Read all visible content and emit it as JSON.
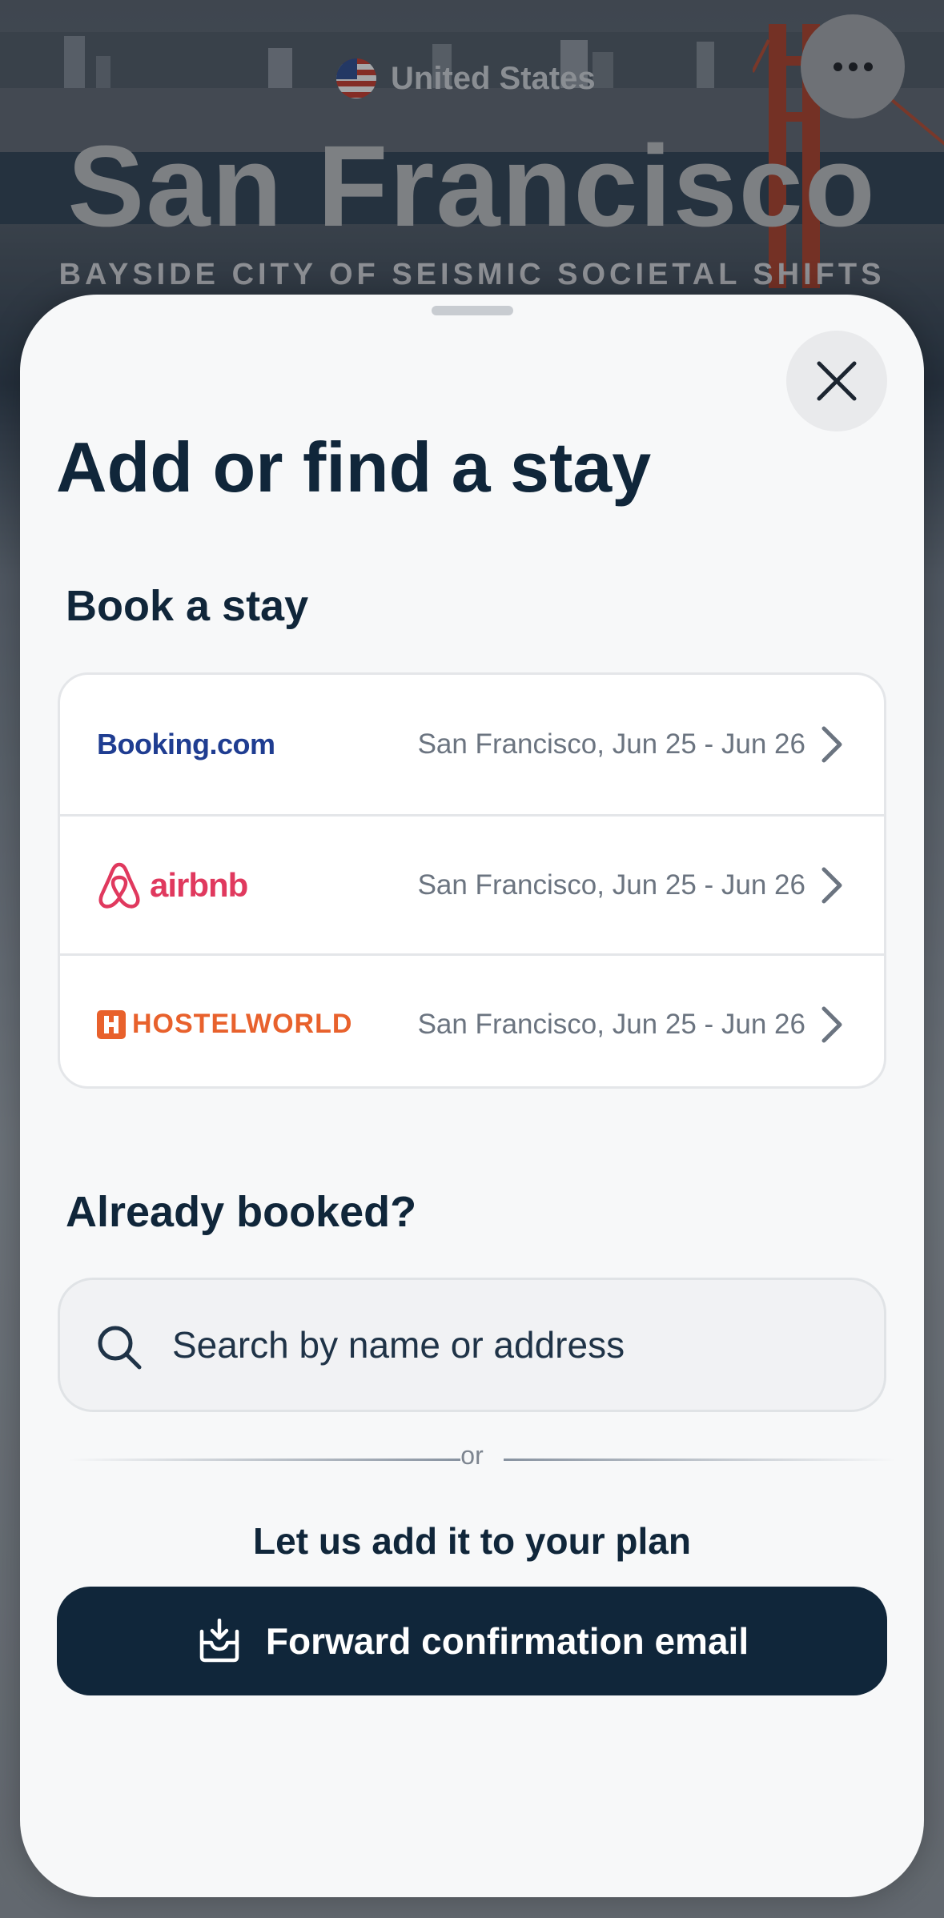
{
  "header": {
    "country": "United States",
    "city": "San Francisco",
    "tagline": "BAYSIDE CITY OF SEISMIC SOCIETAL SHIFTS"
  },
  "sheet": {
    "title": "Add or find a stay",
    "book_section": {
      "title": "Book a stay",
      "providers": [
        {
          "name": "Booking.com",
          "detail": "San Francisco, Jun 25 - Jun 26",
          "brand_color": "#1f3d91"
        },
        {
          "name": "airbnb",
          "detail": "San Francisco, Jun 25 - Jun 26",
          "brand_color": "#e0395e"
        },
        {
          "name": "HOSTELWORLD",
          "detail": "San Francisco, Jun 25 - Jun 26",
          "brand_color": "#e8612c"
        }
      ]
    },
    "booked_section": {
      "title": "Already booked?",
      "search_placeholder": "Search by name or address",
      "or_label": "or",
      "add_prompt": "Let us add it to your plan",
      "forward_button": "Forward confirmation email"
    }
  },
  "colors": {
    "primary": "#10263a",
    "sheet_bg": "#f7f8f9",
    "muted_text": "#6b7480"
  }
}
